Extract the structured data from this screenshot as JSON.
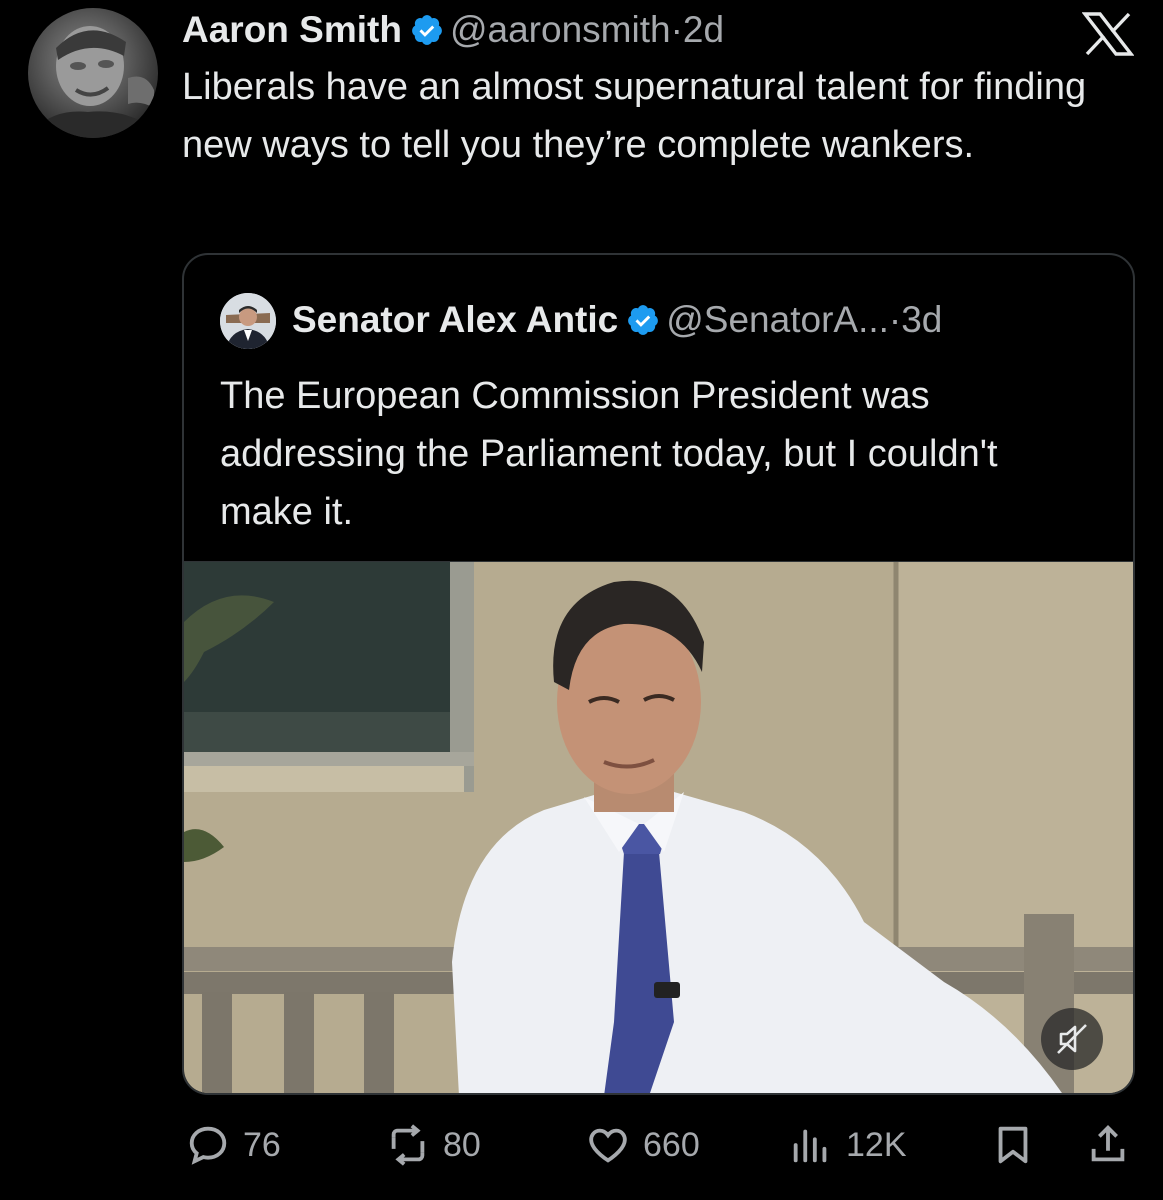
{
  "tweet": {
    "author_name": "Aaron Smith",
    "handle": "@aaronsmith",
    "separator": "·",
    "time": "2d",
    "text": "Liberals have an almost supernatural talent for finding new ways to tell you they’re complete wankers."
  },
  "quoted": {
    "author_name": "Senator Alex Antic",
    "handle": "@SenatorA...",
    "separator": "·",
    "time": "3d",
    "text": "The European Commission President was addressing the Parliament today, but I couldn't make it."
  },
  "actions": {
    "replies": "76",
    "reposts": "80",
    "likes": "660",
    "views": "12K"
  },
  "icons": {
    "brand": "x-logo-icon",
    "verified": "verified-badge-icon",
    "mute": "muted-speaker-icon",
    "reply": "reply-bubble-icon",
    "repost": "repost-icon",
    "like": "heart-icon",
    "views": "bar-chart-icon",
    "bookmark": "bookmark-icon",
    "share": "share-icon"
  },
  "colors": {
    "background": "#000000",
    "text": "#e7e9ea",
    "muted": "#a6a9ad",
    "verified": "#1d9bf0",
    "border": "#2f3336"
  }
}
